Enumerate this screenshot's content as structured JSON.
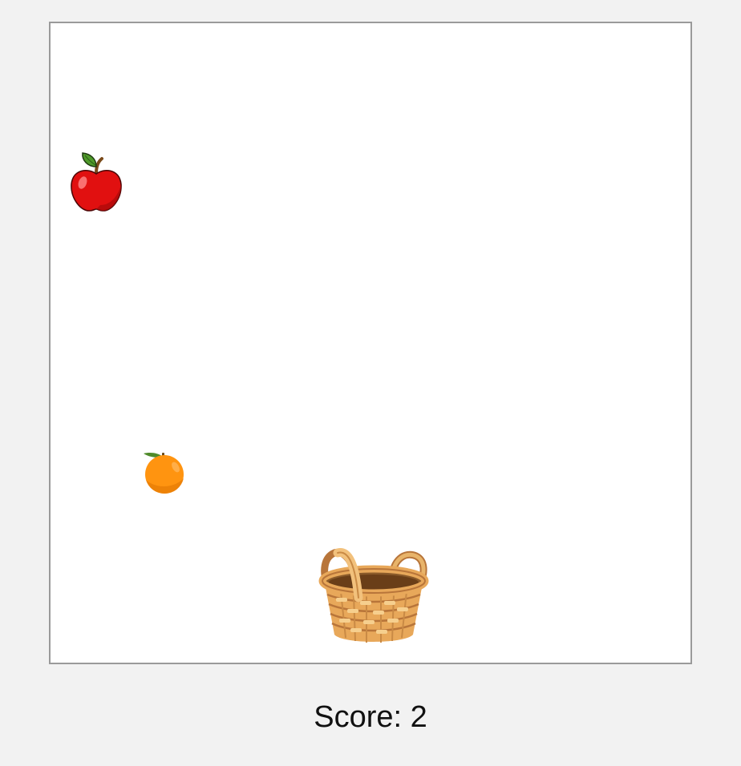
{
  "score": {
    "label": "Score:",
    "value": "2",
    "text": "Score: 2"
  },
  "board": {
    "background": "#ffffff",
    "border_color": "#9a9a9a"
  },
  "items": [
    {
      "name": "apple",
      "icon": "apple-icon",
      "color": "#e11010"
    },
    {
      "name": "orange",
      "icon": "orange-icon",
      "color": "#ff9410"
    }
  ],
  "player": {
    "name": "basket",
    "icon": "basket-icon",
    "color": "#d9944a"
  }
}
